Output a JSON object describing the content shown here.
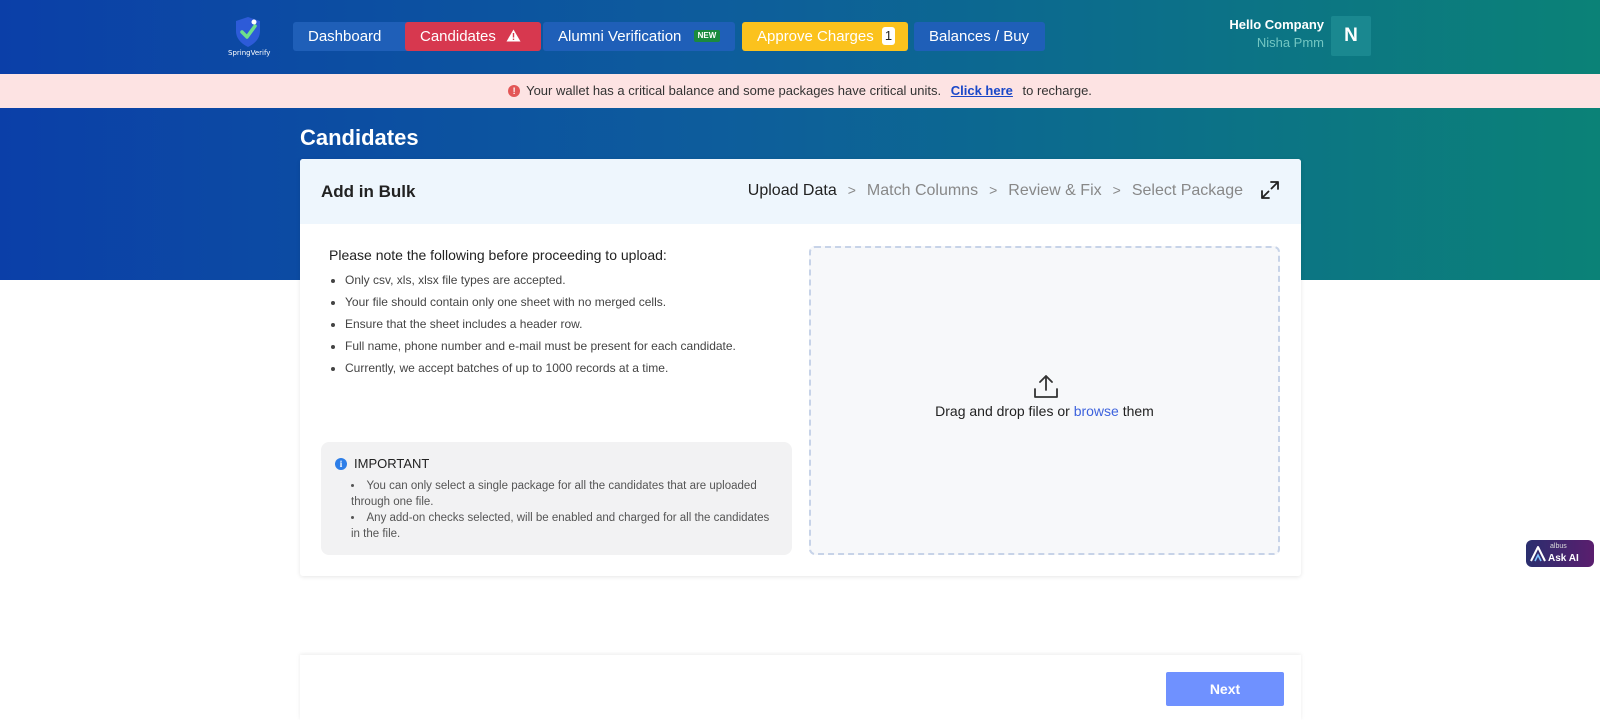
{
  "brand": {
    "logo_text": "SpringVerify"
  },
  "nav": {
    "dashboard": "Dashboard",
    "candidates": "Candidates",
    "alumni": "Alumni Verification",
    "alumni_badge": "NEW",
    "approve": "Approve Charges",
    "approve_count": "1",
    "balances": "Balances / Buy"
  },
  "user": {
    "greeting": "Hello Company",
    "name": "Nisha Pmm",
    "initial": "N"
  },
  "alert": {
    "message": "Your wallet has a critical balance and some packages have critical units.",
    "link": "Click here",
    "suffix": "to recharge."
  },
  "page": {
    "title": "Candidates"
  },
  "card": {
    "title": "Add in Bulk",
    "steps": [
      "Upload Data",
      "Match Columns",
      "Review & Fix",
      "Select Package"
    ],
    "notes_title": "Please note the following before proceeding to upload:",
    "notes": [
      "Only csv, xls, xlsx file types are accepted.",
      "Your file should contain only one sheet with no merged cells.",
      "Ensure that the sheet includes a header row.",
      "Full name, phone number and e-mail must be present for each candidate.",
      "Currently, we accept batches of up to 1000 records at a time."
    ],
    "important_title": "IMPORTANT",
    "important_items": [
      "You can only select a single package for all the candidates that are uploaded through one file.",
      "Any add-on checks selected, will be enabled and charged for all the candidates in the file."
    ],
    "drop_prefix": "Drag and drop files or",
    "drop_link": "browse",
    "drop_suffix": "them"
  },
  "footer": {
    "next": "Next"
  },
  "ask_ai": {
    "brand": "albus",
    "label": "Ask AI"
  },
  "colors": {
    "candidates_button": "#d7384f",
    "approve_button": "#fbc21d",
    "nav_button": "#1f5fb8",
    "next_button": "#6f91ff",
    "alert_background": "#fde3e3"
  }
}
